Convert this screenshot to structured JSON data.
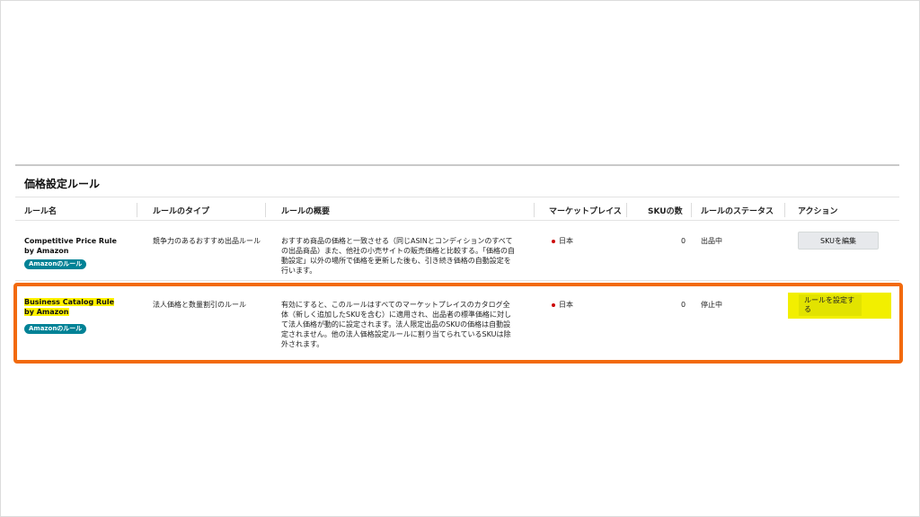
{
  "panel": {
    "title": "価格設定ルール"
  },
  "headers": [
    "ルール名",
    "ルールのタイプ",
    "ルールの概要",
    "マーケットプレイス",
    "SKUの数",
    "ルールのステータス",
    "アクション"
  ],
  "rows": [
    {
      "name": "Competitive Price Rule by Amazon",
      "badge": "Amazonのルール",
      "type": "競争力のあるおすすめ出品ルール",
      "summary": "おすすめ商品の価格と一致させる（同じASINとコンディションのすべての出品商品）また、他社の小売サイトの販売価格と比較する。「価格の自動設定」以外の場所で価格を更新した後も、引き続き価格の自動設定を行います。",
      "marketplace": "日本",
      "sku_count": "0",
      "status": "出品中",
      "action": "SKUを編集"
    },
    {
      "name": "Business Catalog Rule by Amazon",
      "badge": "Amazonのルール",
      "type": "法人価格と数量割引のルール",
      "summary": "有効にすると、このルールはすべてのマーケットプレイスのカタログ全体（新しく追加したSKUを含む）に適用され、出品者の標準価格に対して法人価格が動的に設定されます。法人限定出品のSKUの価格は自動設定されません。他の法人価格設定ルールに割り当てられているSKUは除外されます。",
      "marketplace": "日本",
      "sku_count": "0",
      "status": "停止中",
      "action": "ルールを設定する"
    }
  ],
  "colors": {
    "highlight": "#fff200",
    "emphasis_box": "#f26a0d",
    "badge": "#008296"
  }
}
